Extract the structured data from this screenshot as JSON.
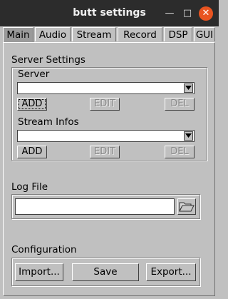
{
  "window": {
    "title": "butt settings"
  },
  "tabs": [
    "Main",
    "Audio",
    "Stream",
    "Record",
    "DSP",
    "GUI"
  ],
  "server_settings": {
    "title": "Server Settings",
    "server": {
      "label": "Server",
      "value": "",
      "add": "ADD",
      "edit": "EDIT",
      "del": "DEL"
    },
    "stream_infos": {
      "label": "Stream Infos",
      "value": "",
      "add": "ADD",
      "edit": "EDIT",
      "del": "DEL"
    }
  },
  "log_file": {
    "label": "Log File",
    "value": ""
  },
  "configuration": {
    "label": "Configuration",
    "import": "Import...",
    "save": "Save",
    "export": "Export..."
  },
  "icons": {
    "close": "close-icon",
    "minimize": "minimize-icon",
    "maximize": "maximize-icon",
    "folder": "folder-open-icon",
    "dropdown": "chevron-down-icon"
  },
  "colors": {
    "titlebar": "#2c2c2c",
    "close": "#e95420",
    "background": "#c0c0c0",
    "active_tab": "#9a9a9a"
  }
}
